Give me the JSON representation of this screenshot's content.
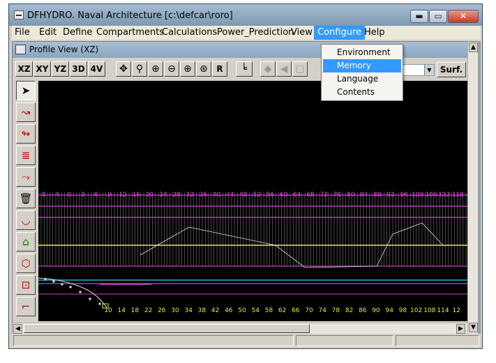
{
  "window": {
    "title": "DFHYDRO. Naval Architecture [c:\\defcar\\roro]",
    "minimize_glyph": "▬",
    "maximize_glyph": "▭",
    "close_glyph": "✕"
  },
  "menubar": {
    "items": [
      "File",
      "Edit",
      "Define",
      "Compartments",
      "Calculations",
      "Power_Prediction",
      "View",
      "Configure",
      "Help"
    ],
    "active": "Configure"
  },
  "configure_menu": {
    "items": [
      "Environment",
      "Memory",
      "Language",
      "Contents"
    ],
    "highlighted": "Memory"
  },
  "child_window": {
    "title": "Profile View (XZ)"
  },
  "toolbar": {
    "view_buttons": [
      "XZ",
      "XY",
      "YZ",
      "3D",
      "4V"
    ],
    "reset_label": "R",
    "surface_select_value": "",
    "surface_button": "Surf.",
    "icons": [
      "pan-icon",
      "zoom-window-icon",
      "zoom-in-icon",
      "zoom-out-icon",
      "zoom-extent-icon",
      "zoom-previous-icon",
      "axis-icon"
    ]
  },
  "left_tools": {
    "icons": [
      "pointer-icon",
      "add-point-icon",
      "insert-point-icon",
      "edit-point-icon",
      "curve-icon",
      "delete-icon",
      "section-icon",
      "station-icon",
      "body-icon",
      "plane-icon",
      "profile-icon"
    ]
  },
  "profile_chart": {
    "top_ticks": [
      "-8",
      "-4",
      "0",
      "3",
      "6",
      "9",
      "12",
      "16",
      "20",
      "24",
      "28",
      "32",
      "36",
      "40",
      "44",
      "48",
      "52",
      "56",
      "60",
      "64",
      "68",
      "72",
      "76",
      "80",
      "84",
      "88",
      "92",
      "96",
      "100",
      "106",
      "112",
      "118"
    ],
    "bottom_ticks": [
      "10",
      "14",
      "18",
      "22",
      "26",
      "30",
      "34",
      "38",
      "42",
      "46",
      "50",
      "54",
      "58",
      "62",
      "66",
      "70",
      "74",
      "78",
      "82",
      "86",
      "90",
      "94",
      "98",
      "102",
      "108",
      "114",
      "12"
    ],
    "colors": {
      "background": "#000000",
      "stations": "#c8c8c8",
      "waterlines": "#d040d0",
      "design_waterline": "#e8e840",
      "cyan_line": "#40d0d0",
      "hull_curve": "#e0e0e0",
      "bow_points": "#e8e840"
    }
  }
}
